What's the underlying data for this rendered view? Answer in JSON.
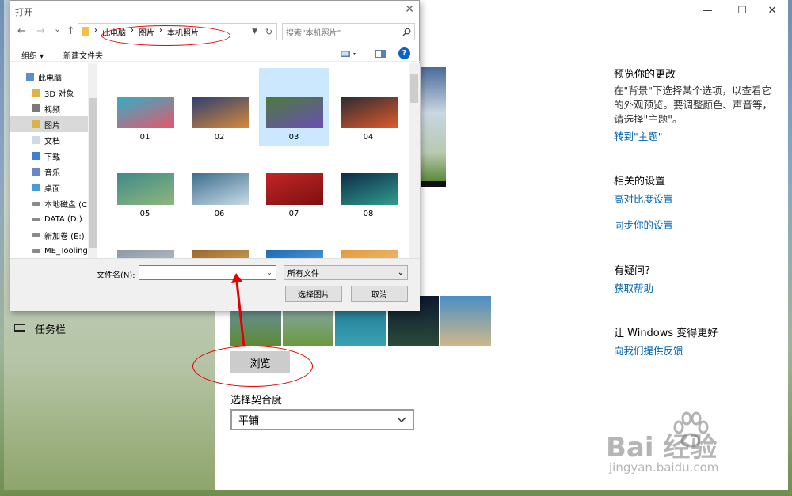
{
  "dialog": {
    "title": "打开",
    "close": "✕",
    "nav": {
      "back": "←",
      "forward": "→",
      "recent": "⌄",
      "up": "↑"
    },
    "address": [
      "此电脑",
      "图片",
      "本机照片"
    ],
    "address_sep": "›",
    "refresh": "↻",
    "search_placeholder": "搜索\"本机照片\"",
    "toolbar": {
      "organize": "组织 ▾",
      "new_folder": "新建文件夹",
      "help": "?"
    },
    "nav_items": [
      {
        "label": "此电脑",
        "icon": "pc-icon"
      },
      {
        "label": "3D 对象",
        "icon": "folder-3d-icon"
      },
      {
        "label": "视频",
        "icon": "video-folder-icon"
      },
      {
        "label": "图片",
        "icon": "pictures-folder-icon",
        "selected": true
      },
      {
        "label": "文档",
        "icon": "documents-folder-icon"
      },
      {
        "label": "下载",
        "icon": "download-folder-icon"
      },
      {
        "label": "音乐",
        "icon": "music-folder-icon"
      },
      {
        "label": "桌面",
        "icon": "desktop-folder-icon"
      },
      {
        "label": "本地磁盘 (C:",
        "icon": "drive-icon"
      },
      {
        "label": "DATA (D:)",
        "icon": "drive-icon"
      },
      {
        "label": "新加卷 (E:)",
        "icon": "drive-icon"
      },
      {
        "label": "ME_Tooling",
        "icon": "drive-icon"
      }
    ],
    "files": [
      {
        "name": "01",
        "colors": [
          "#2fb0c8",
          "#e7566a"
        ]
      },
      {
        "name": "02",
        "colors": [
          "#2b3d73",
          "#d78a3a"
        ]
      },
      {
        "name": "03",
        "colors": [
          "#4c7b3a",
          "#6a4fb5"
        ],
        "selected": true
      },
      {
        "name": "04",
        "colors": [
          "#2a2a35",
          "#e05a2b"
        ]
      },
      {
        "name": "05",
        "colors": [
          "#3f8a8a",
          "#8fb77a"
        ]
      },
      {
        "name": "06",
        "colors": [
          "#3c6e8f",
          "#c9dbe6"
        ]
      },
      {
        "name": "07",
        "colors": [
          "#c42525",
          "#7d1010"
        ]
      },
      {
        "name": "08",
        "colors": [
          "#0e2a48",
          "#2f9d8d"
        ]
      },
      {
        "name": "",
        "colors": [
          "#8a9aa8",
          "#c3ccd4"
        ]
      },
      {
        "name": "",
        "colors": [
          "#9a6a2f",
          "#e4b260"
        ]
      },
      {
        "name": "",
        "colors": [
          "#1b6bb3",
          "#6ab0e6"
        ]
      },
      {
        "name": "",
        "colors": [
          "#e39b3a",
          "#f1c88a"
        ]
      }
    ],
    "filename_label": "文件名(N):",
    "filename_value": "",
    "filetype": "所有文件",
    "choose_button": "选择图片",
    "cancel_button": "取消"
  },
  "settings": {
    "window_controls": {
      "min": "—",
      "max": "☐",
      "close": "✕"
    },
    "sidebar_taskbar": "任务栏",
    "thumbnails": [
      {
        "colors": [
          "#6a8fb8",
          "#5d8a35"
        ]
      },
      {
        "colors": [
          "#8fa8c0",
          "#6b9a3f"
        ]
      },
      {
        "colors": [
          "#1e6f8a",
          "#39a2b5"
        ]
      },
      {
        "colors": [
          "#0c1830",
          "#2b4a3a"
        ]
      },
      {
        "colors": [
          "#4a8fc6",
          "#cfb88a"
        ]
      }
    ],
    "browse_button": "浏览",
    "fit_label": "选择契合度",
    "fit_value": "平铺",
    "right": {
      "preview_title": "预览你的更改",
      "preview_text": "在\"背景\"下选择某个选项，以查看它的外观预览。要调整颜色、声音等，请选择\"主题\"。",
      "preview_link": "转到\"主题\"",
      "related_title": "相关的设置",
      "contrast_link": "高对比度设置",
      "sync_link": "同步你的设置",
      "question_title": "有疑问?",
      "help_link": "获取帮助",
      "improve_title": "让 Windows 变得更好",
      "feedback_link": "向我们提供反馈"
    }
  },
  "watermark": {
    "main": "Bai 经验",
    "sub": "jingyan.baidu.com"
  },
  "colors": {
    "link": "#0063b1",
    "annotation": "#e60000",
    "selection": "#cce8ff"
  }
}
